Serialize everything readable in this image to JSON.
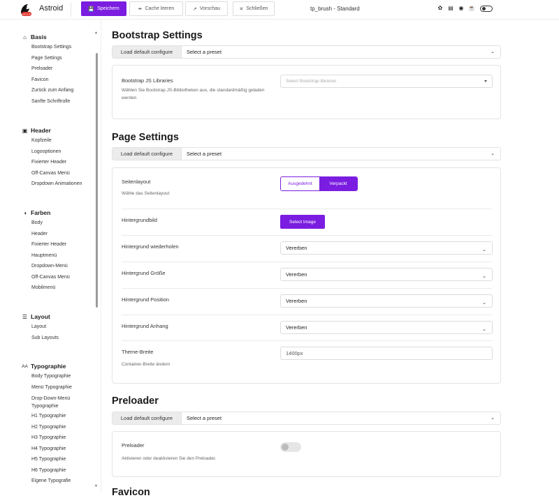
{
  "topbar": {
    "app_name": "Astroid",
    "logo_badge": "v3.1.5",
    "save_label": "Speichern",
    "clear_cache_label": "Cache leeren",
    "preview_label": "Vorschau",
    "close_label": "Schließen",
    "title": "tp_brush - Standard"
  },
  "sidebar": {
    "groups": [
      {
        "label": "Basis",
        "icon": "home-icon",
        "items": [
          "Bootstrap Settings",
          "Page Settings",
          "Preloader",
          "Favicon",
          "Zurück zum Anfang",
          "Sanfte Schriftrolle"
        ]
      },
      {
        "label": "Header",
        "icon": "header-icon",
        "items": [
          "Kopfzeile",
          "Logooptionen",
          "Fixierter Header",
          "Off-Canvas Menü",
          "Dropdown Animationen"
        ]
      },
      {
        "label": "Farben",
        "icon": "palette-icon",
        "items": [
          "Body",
          "Header",
          "Fixierter Header",
          "Hauptmenü",
          "Dropdown-Menü",
          "Off-Canvas Menü",
          "Mobilmenü"
        ]
      },
      {
        "label": "Layout",
        "icon": "layers-icon",
        "items": [
          "Layout",
          "Sub Layouts"
        ]
      },
      {
        "label": "Typographie",
        "icon": "font-size-icon",
        "items": [
          "Body Typographie",
          "Menü Typographie",
          "Drop-Down-Menü Typographie",
          "H1 Typographie",
          "H2 Typographie",
          "H3 Typographie",
          "H4 Typographie",
          "H5 Typographie",
          "H6 Typographie",
          "Eigene Typografie"
        ]
      }
    ]
  },
  "preset": {
    "load_label": "Load default configure",
    "select_label": "Select a preset"
  },
  "sections": {
    "bootstrap": {
      "title": "Bootstrap Settings",
      "libs_label": "Bootstrap JS Libraries",
      "libs_desc": "Wählen Sie Bootstrap JS-Bibliotheken aus, die standardmäßig geladen werden",
      "libs_placeholder": "Select Bootstrap libraries"
    },
    "page": {
      "title": "Page Settings",
      "layout_label": "Seitenlayout",
      "layout_desc": "Wähle das Seitenlayout",
      "layout_options": [
        "Ausgedehnt",
        "Verpackt"
      ],
      "layout_selected": "Verpackt",
      "bg_image_label": "Hintergrundbild",
      "select_image_label": "Select Image",
      "bg_repeat_label": "Hintergrund wiederholen",
      "bg_repeat_value": "Vererben",
      "bg_size_label": "Hintergrund Größe",
      "bg_size_value": "Vererben",
      "bg_position_label": "Hintergrund Position",
      "bg_position_value": "Vererben",
      "bg_attach_label": "Hintergrund Anhang",
      "bg_attach_value": "Vererben",
      "theme_width_label": "Theme-Breite",
      "theme_width_desc": "Container-Breite ändern",
      "theme_width_value": "1400px"
    },
    "preloader": {
      "title": "Preloader",
      "label": "Preloader",
      "desc": "Aktivieren oder deaktivieren Sie den Preloader.",
      "enabled": false
    },
    "favicon": {
      "title": "Favicon"
    }
  }
}
